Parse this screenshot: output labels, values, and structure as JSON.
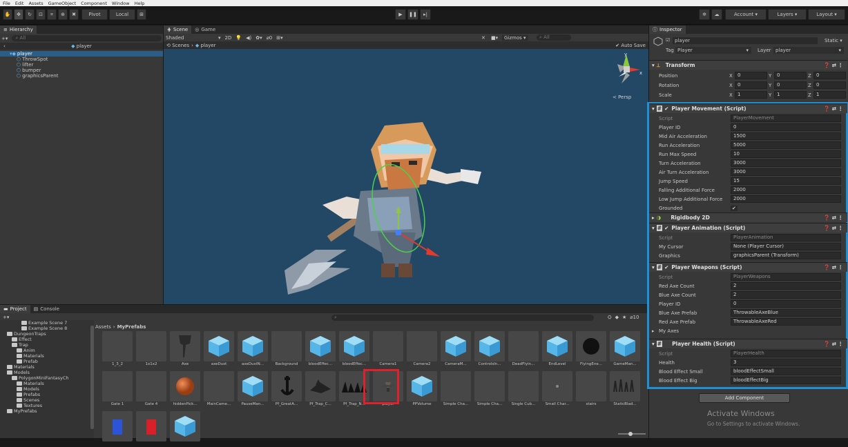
{
  "menu": [
    "File",
    "Edit",
    "Assets",
    "GameObject",
    "Component",
    "Window",
    "Help"
  ],
  "toolbar": {
    "pivot": "Pivot",
    "local": "Local",
    "account": "Account",
    "layers": "Layers",
    "layout": "Layout"
  },
  "hierarchy": {
    "tab": "Hierarchy",
    "search_placeholder": "All",
    "scene_name": "player",
    "items": [
      {
        "label": "player",
        "depth": 0,
        "selected": true
      },
      {
        "label": "ThrowSpot",
        "depth": 1
      },
      {
        "label": "lifter",
        "depth": 1
      },
      {
        "label": "bumper",
        "depth": 1
      },
      {
        "label": "graphicsParent",
        "depth": 1
      }
    ]
  },
  "scene": {
    "tabs": [
      "Scene",
      "Game"
    ],
    "shading": "Shaded",
    "mode_2d": "2D",
    "gizmos": "Gizmos",
    "search_placeholder": "All",
    "breadcrumb_scenes": "Scenes",
    "breadcrumb_prefab": "player",
    "auto_save": "Auto Save",
    "persp": "< Persp"
  },
  "project": {
    "tabs": [
      "Project",
      "Console"
    ],
    "breadcrumb": [
      "Assets",
      "MyPrefabs"
    ],
    "zoom_label": "10",
    "tree": [
      {
        "label": "Example Scene 7",
        "depth": 3
      },
      {
        "label": "Example Scene 8",
        "depth": 3
      },
      {
        "label": "DungeonTraps",
        "depth": 0
      },
      {
        "label": "Effect",
        "depth": 1
      },
      {
        "label": "Trap",
        "depth": 1
      },
      {
        "label": "Anim",
        "depth": 2
      },
      {
        "label": "Materials",
        "depth": 2
      },
      {
        "label": "Prefab",
        "depth": 2
      },
      {
        "label": "Materials",
        "depth": 0
      },
      {
        "label": "Models",
        "depth": 0
      },
      {
        "label": "PolygonMiniFantasyCh",
        "depth": 1
      },
      {
        "label": "Materials",
        "depth": 2
      },
      {
        "label": "Models",
        "depth": 2
      },
      {
        "label": "Prefabs",
        "depth": 2
      },
      {
        "label": "Scenes",
        "depth": 2
      },
      {
        "label": "Textures",
        "depth": 2
      },
      {
        "label": "MyPrefabs",
        "depth": 0
      }
    ],
    "row1": [
      {
        "label": "1_3_2",
        "icon": "blank"
      },
      {
        "label": "1x1x2",
        "icon": "blank"
      },
      {
        "label": "Axe",
        "icon": "axe"
      },
      {
        "label": "axeDust",
        "icon": "cube"
      },
      {
        "label": "axeDustN...",
        "icon": "cube"
      },
      {
        "label": "Background",
        "icon": "blank"
      },
      {
        "label": "bloodEffec...",
        "icon": "cube"
      },
      {
        "label": "bloodEffec...",
        "icon": "cube"
      },
      {
        "label": "Camera1",
        "icon": "blank"
      },
      {
        "label": "Camera2",
        "icon": "blank"
      },
      {
        "label": "CameraM...",
        "icon": "cube"
      },
      {
        "label": "Controlsln...",
        "icon": "cube"
      },
      {
        "label": "DeadFlyin...",
        "icon": "blank"
      },
      {
        "label": "EndLevel",
        "icon": "cube"
      },
      {
        "label": "FlyingEne...",
        "icon": "sphere-black"
      },
      {
        "label": "GameMan...",
        "icon": "cube"
      }
    ],
    "row2": [
      {
        "label": "Gate 1",
        "icon": "blank"
      },
      {
        "label": "Gate 4",
        "icon": "blank"
      },
      {
        "label": "hiddenPick...",
        "icon": "sphere-orange"
      },
      {
        "label": "MainCame...",
        "icon": "blank"
      },
      {
        "label": "PauseMan...",
        "icon": "cube"
      },
      {
        "label": "Pf_GreatA...",
        "icon": "anchor"
      },
      {
        "label": "Pf_Trap_C...",
        "icon": "trap"
      },
      {
        "label": "Pf_Trap_N...",
        "icon": "spikes"
      },
      {
        "label": "player",
        "icon": "player",
        "highlight": true
      },
      {
        "label": "PPVolume",
        "icon": "cube"
      },
      {
        "label": "Simple Cha...",
        "icon": "blank"
      },
      {
        "label": "Simple Cha...",
        "icon": "blank"
      },
      {
        "label": "Single Cub...",
        "icon": "blank"
      },
      {
        "label": "Small Char...",
        "icon": "dot"
      },
      {
        "label": "stairs",
        "icon": "blank"
      },
      {
        "label": "StaticBlad...",
        "icon": "blades"
      }
    ],
    "row3": [
      {
        "icon": "blue"
      },
      {
        "icon": "red"
      },
      {
        "icon": "cube"
      }
    ]
  },
  "inspector": {
    "tab": "Inspector",
    "object_name": "player",
    "static_label": "Static",
    "tag_label": "Tag",
    "tag_value": "Player",
    "layer_label": "Layer",
    "layer_value": "player",
    "transform": {
      "title": "Transform",
      "rows": [
        {
          "label": "Position",
          "x": "0",
          "y": "0",
          "z": "0"
        },
        {
          "label": "Rotation",
          "x": "0",
          "y": "0",
          "z": "0"
        },
        {
          "label": "Scale",
          "x": "1",
          "y": "1",
          "z": "1"
        }
      ]
    },
    "movement": {
      "title": "Player Movement (Script)",
      "script_label": "Script",
      "script_value": "PlayerMovement",
      "rows": [
        {
          "label": "Player ID",
          "value": "0"
        },
        {
          "label": "Mid Air Acceleration",
          "value": "1500"
        },
        {
          "label": "Run Acceleration",
          "value": "5000"
        },
        {
          "label": "Run Max Speed",
          "value": "10"
        },
        {
          "label": "Turn Acceleration",
          "value": "3000"
        },
        {
          "label": "Air Turn Acceleration",
          "value": "3000"
        },
        {
          "label": "Jump Speed",
          "value": "15"
        },
        {
          "label": "Falling Additional Force",
          "value": "2000"
        },
        {
          "label": "Low Jump Additional Force",
          "value": "2000"
        }
      ],
      "grounded_label": "Grounded"
    },
    "rigidbody": {
      "title": "Rigidbody 2D"
    },
    "animation": {
      "title": "Player Animation (Script)",
      "script_label": "Script",
      "script_value": "PlayerAnimation",
      "rows": [
        {
          "label": "My Cursor",
          "value": "None (Player Cursor)"
        },
        {
          "label": "Graphics",
          "value": "graphicsParent (Transform)"
        }
      ]
    },
    "weapons": {
      "title": "Player Weapons (Script)",
      "script_label": "Script",
      "script_value": "PlayerWeapons",
      "rows": [
        {
          "label": "Red Axe Count",
          "value": "2"
        },
        {
          "label": "Blue Axe Count",
          "value": "2"
        },
        {
          "label": "Player ID",
          "value": "0"
        },
        {
          "label": "Blue Axe Prefab",
          "value": "ThrowableAxeBlue"
        },
        {
          "label": "Red Axe Prefab",
          "value": "ThrowableAxeRed"
        }
      ],
      "my_axes": "My Axes"
    },
    "health": {
      "title": "Player Health (Script)",
      "script_label": "Script",
      "script_value": "PlayerHealth",
      "rows": [
        {
          "label": "Health",
          "value": "3"
        },
        {
          "label": "Blood Effect Small",
          "value": "bloodEffectSmall"
        },
        {
          "label": "Blood Effect Big",
          "value": "bloodEffectBig"
        }
      ]
    },
    "add_component": "Add Component"
  },
  "watermark": {
    "title": "Activate Windows",
    "subtitle": "Go to Settings to activate Windows."
  },
  "colors": {
    "highlight_blue": "#1e90d6",
    "highlight_red": "#e0202a",
    "scene_bg": "#224866",
    "selection": "#2c5d87"
  }
}
